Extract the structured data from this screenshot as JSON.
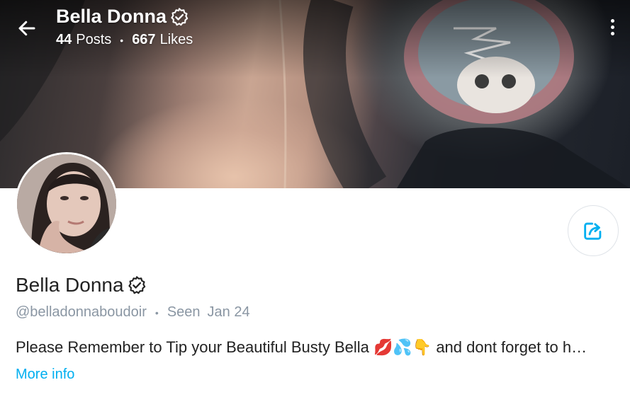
{
  "header": {
    "title": "Bella Donna",
    "posts_count": "44",
    "posts_label": "Posts",
    "likes_count": "667",
    "likes_label": "Likes",
    "separator": "•"
  },
  "profile": {
    "name": "Bella Donna",
    "handle": "@belladonnaboudoir",
    "separator": "•",
    "seen_label": "Seen",
    "seen_date": "Jan 24",
    "bio": "Please Remember to Tip your Beautiful Busty Bella 💋💦👇 and dont forget to h…",
    "more_info": "More info",
    "verified": true
  },
  "colors": {
    "accent": "#00aff0",
    "muted": "#8a96a3",
    "text": "#222222"
  },
  "icons": {
    "back": "back-arrow-icon",
    "verified": "verified-badge-icon",
    "more": "more-vertical-icon",
    "share": "share-icon"
  }
}
